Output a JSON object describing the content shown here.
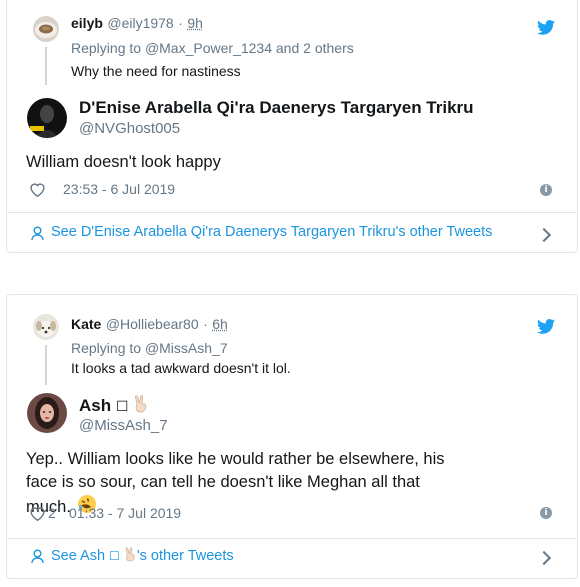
{
  "tweet1": {
    "reply": {
      "name": "eilyb",
      "handle": "@eily1978",
      "sep": "·",
      "time": "9h",
      "replying_prefix": "Replying to",
      "replying_to": "@Max_Power_1234",
      "replying_suffix": "and 2 others",
      "text": "Why the need for nastiness"
    },
    "main": {
      "name": "D'Enise Arabella Qi'ra Daenerys Targaryen Trikru",
      "handle": "@NVGhost005",
      "text": "William doesn't look happy",
      "timestamp": "23:53 - 6 Jul 2019",
      "likes": ""
    },
    "see_other": "See D'Enise Arabella Qi'ra Daenerys Targaryen Trikru's other Tweets"
  },
  "tweet2": {
    "reply": {
      "name": "Kate",
      "handle": "@Holliebear80",
      "sep": "·",
      "time": "6h",
      "replying_prefix": "Replying to",
      "replying_to": "@MissAsh_7",
      "text": "It looks a tad awkward doesn't it lol."
    },
    "main": {
      "name": "Ash",
      "name_glyph": "☐",
      "handle": "@MissAsh_7",
      "text": "Yep.. William looks like he would rather be elsewhere, his face is so sour, can tell he doesn't like Meghan all that much.",
      "likes": "2",
      "timestamp": "01:33 - 7 Jul 2019"
    },
    "see_prefix": "See Ash",
    "see_glyph": "☐",
    "see_suffix": "'s other Tweets"
  },
  "colors": {
    "link": "#1b95e0",
    "muted": "#657786",
    "border": "#e1e8ed",
    "text": "#14171a"
  },
  "icons": [
    "twitter-bird-icon",
    "heart-icon",
    "info-icon",
    "person-icon",
    "chevron-right-icon",
    "victory-hand-emoji",
    "rofl-emoji"
  ]
}
